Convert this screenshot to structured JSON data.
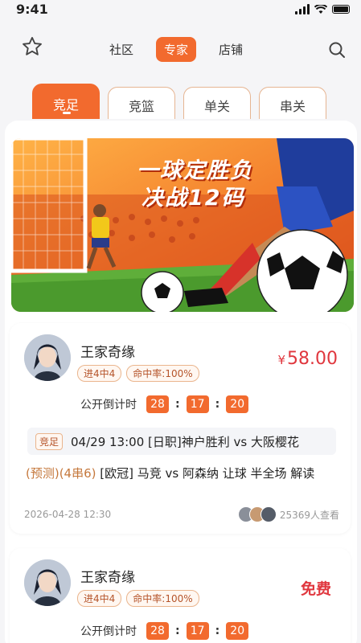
{
  "status_bar": {
    "time": "9:41"
  },
  "nav": {
    "tabs": [
      {
        "label": "社区",
        "active": false
      },
      {
        "label": "专家",
        "active": true
      },
      {
        "label": "店铺",
        "active": false
      }
    ]
  },
  "categories": [
    {
      "label": "竞足",
      "active": true
    },
    {
      "label": "竞篮",
      "active": false
    },
    {
      "label": "单关",
      "active": false
    },
    {
      "label": "串关",
      "active": false
    }
  ],
  "banner": {
    "line1": "一球定胜负",
    "line2": "决战12码"
  },
  "cards": [
    {
      "name": "王家奇缘",
      "badges": [
        "进4中4",
        "命中率:100%"
      ],
      "price_symbol": "¥",
      "price": "58.00",
      "countdown_label": "公开倒计时",
      "countdown": [
        "28",
        "17",
        "20"
      ],
      "match_tag": "竞足",
      "match_text": "04/29 13:00 [日职]神户胜利 vs 大阪樱花",
      "predict_highlight": "(预测)(4串6)",
      "predict_text": " [欧冠] 马竞 vs 阿森纳 让球 半全场 解读",
      "date": "2026-04-28 12:30",
      "viewers": "25369人查看"
    },
    {
      "name": "王家奇缘",
      "badges": [
        "进4中4",
        "命中率:100%"
      ],
      "price": "免费",
      "countdown_label": "公开倒计时",
      "countdown": [
        "28",
        "17",
        "20"
      ]
    }
  ],
  "colors": {
    "accent": "#f26a2e",
    "price": "#e0373e",
    "badge_border": "#eab58d"
  }
}
